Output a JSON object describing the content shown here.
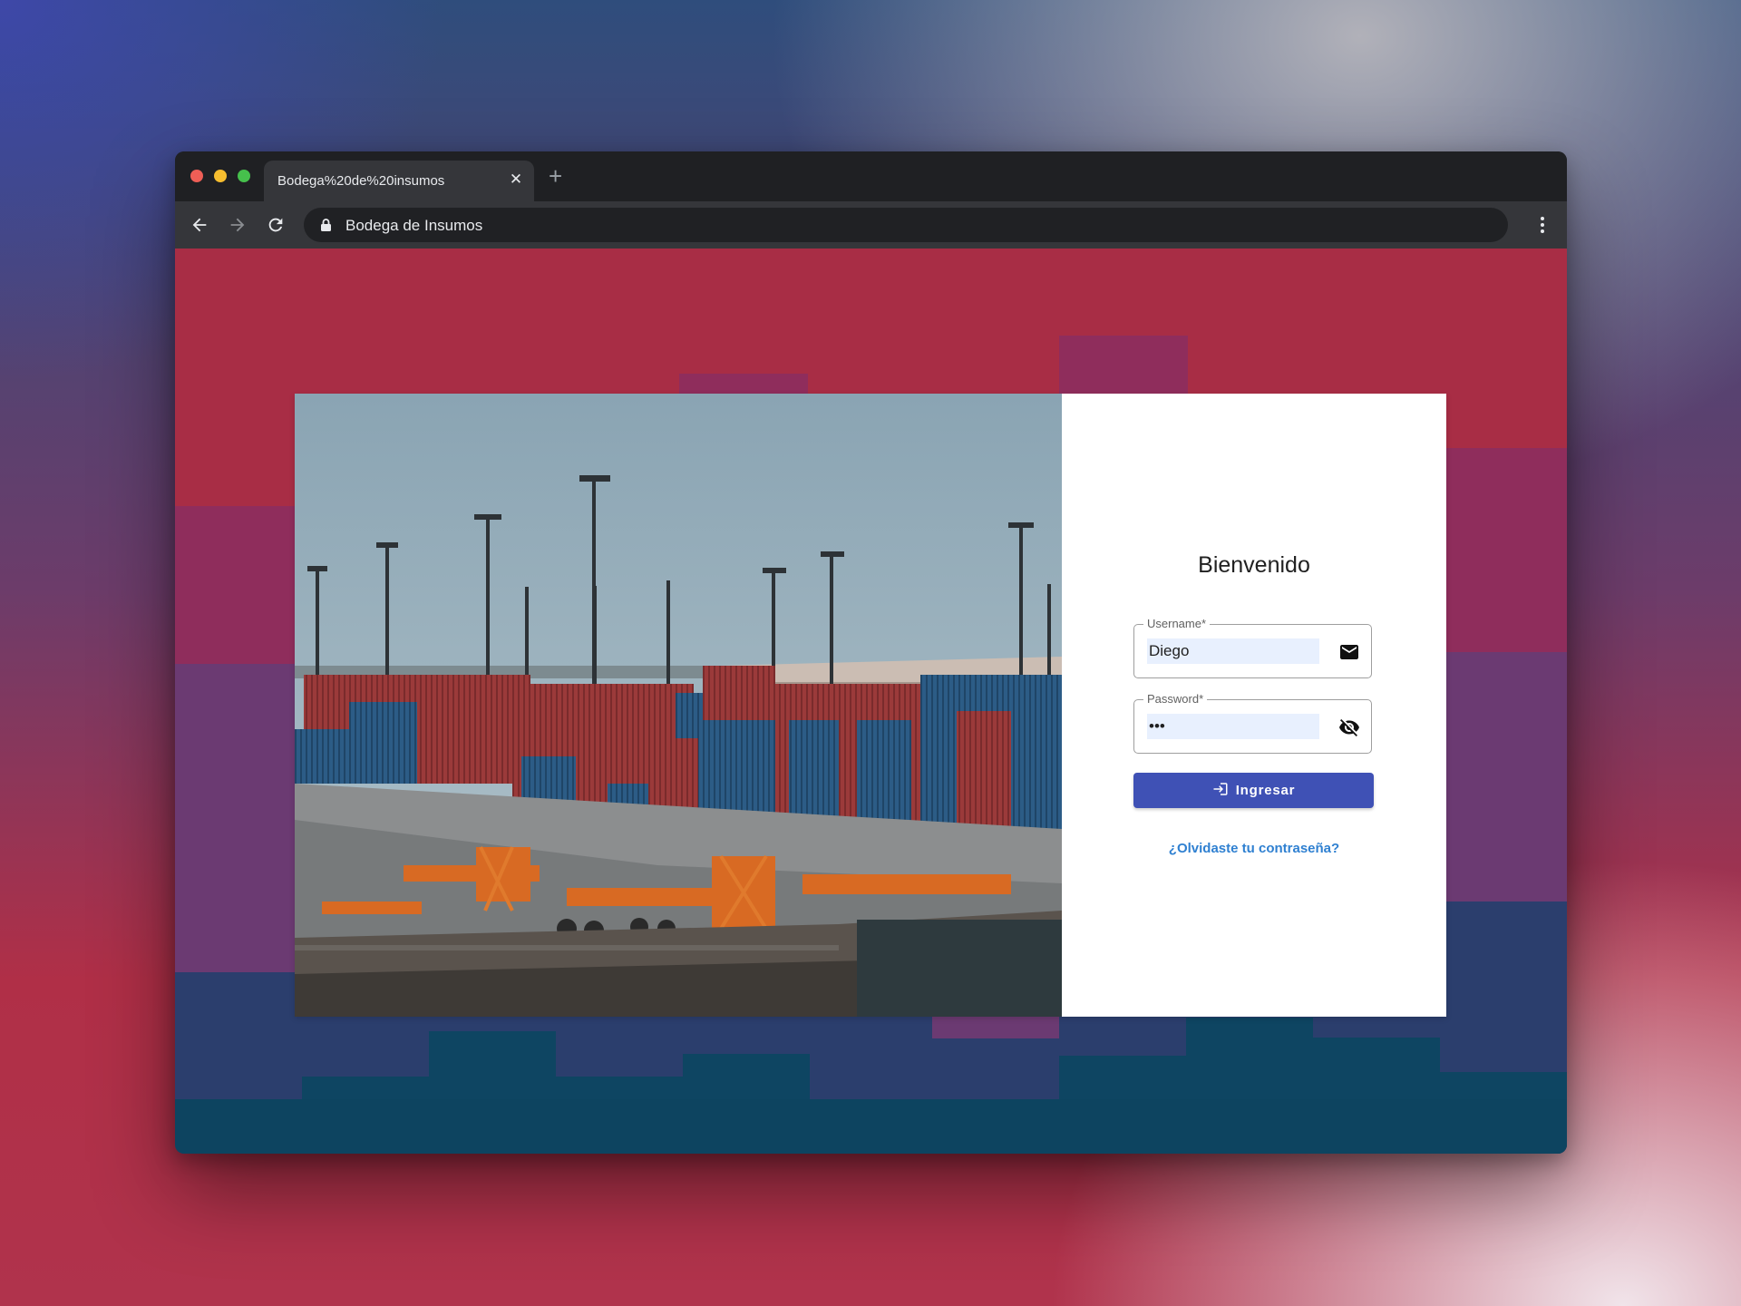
{
  "browser": {
    "tab_title": "Bodega%20de%20insumos",
    "tab_close": "✕",
    "new_tab": "+",
    "address": "Bodega de Insumos"
  },
  "login": {
    "heading": "Bienvenido",
    "username": {
      "label": "Username*",
      "value": "Diego",
      "icon": "mail-icon"
    },
    "password": {
      "label": "Password*",
      "value": "•••",
      "icon": "visibility-off-icon"
    },
    "submit_label": "Ingresar",
    "submit_icon": "login-icon",
    "forgot_link": "¿Olvidaste tu contraseña?"
  },
  "colors": {
    "primary": "#3f51b5",
    "link": "#2f80d1",
    "page_background": "#a82d45"
  }
}
